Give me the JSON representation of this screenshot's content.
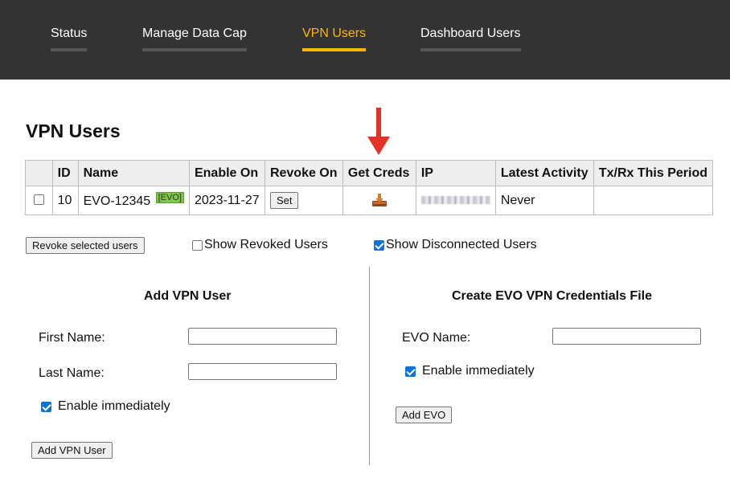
{
  "nav": {
    "items": [
      {
        "label": "Status",
        "active": false
      },
      {
        "label": "Manage Data Cap",
        "active": false
      },
      {
        "label": "VPN Users",
        "active": true
      },
      {
        "label": "Dashboard Users",
        "active": false
      }
    ]
  },
  "page": {
    "title": "VPN Users"
  },
  "table": {
    "headers": [
      "",
      "ID",
      "Name",
      "Enable On",
      "Revoke On",
      "Get Creds",
      "IP",
      "Latest Activity",
      "Tx/Rx This Period"
    ],
    "rows": [
      {
        "id": "10",
        "name": "EVO-12345",
        "tag": "[EVO]",
        "enable_on": "2023-11-27",
        "revoke_button": "Set",
        "get_creds_icon": "download-icon",
        "ip": "",
        "latest_activity": "Never",
        "txrx": ""
      }
    ]
  },
  "controls": {
    "revoke_selected": "Revoke selected users",
    "show_revoked": {
      "label": "Show Revoked Users",
      "checked": false
    },
    "show_disconnected": {
      "label": "Show Disconnected Users",
      "checked": true
    }
  },
  "add_user": {
    "title": "Add VPN User",
    "first_name_label": "First Name:",
    "first_name_value": "",
    "last_name_label": "Last Name:",
    "last_name_value": "",
    "enable_label": "Enable immediately",
    "enable_checked": true,
    "submit": "Add VPN User"
  },
  "evo": {
    "title": "Create EVO VPN Credentials File",
    "name_label": "EVO Name:",
    "name_value": "",
    "enable_label": "Enable immediately",
    "enable_checked": true,
    "submit": "Add EVO"
  },
  "colors": {
    "accent": "#ffb800",
    "topbar": "#333333",
    "arrow": "#e53227",
    "evo_tag": "#7ec84a",
    "checkbox": "#0a74da"
  }
}
